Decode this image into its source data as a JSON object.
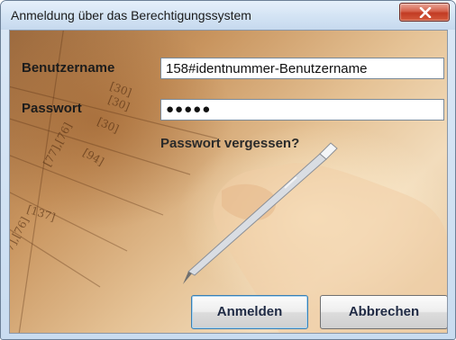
{
  "window": {
    "title": "Anmeldung über das Berechtigungssystem"
  },
  "form": {
    "username_label": "Benutzername",
    "username_value": "158#identnummer-Benutzername",
    "password_label": "Passwort",
    "password_masked": "●●●●●",
    "forgot_password": "Passwort vergessen?"
  },
  "buttons": {
    "login": "Anmelden",
    "cancel": "Abbrechen"
  },
  "background_marks": [
    "[30]",
    "[30]",
    "[30]",
    "[94]",
    "[77],[76]",
    "[137]",
    "7],[76]"
  ],
  "icons": {
    "close": "close-icon"
  },
  "colors": {
    "close_button": "#c23b23",
    "title_bar": "#d3e3f4",
    "default_button_border": "#3c7fb1"
  }
}
